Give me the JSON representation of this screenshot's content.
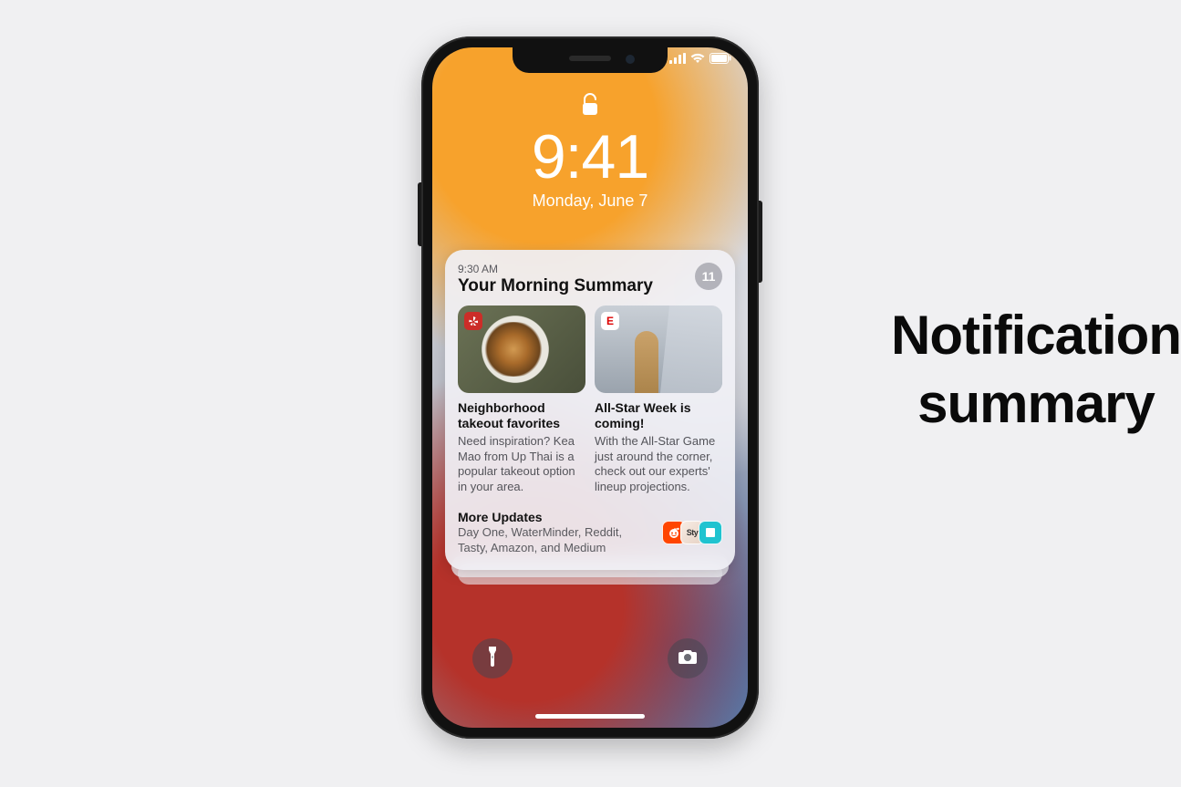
{
  "caption": {
    "line1": "Notification",
    "line2": "summary"
  },
  "lockscreen": {
    "time": "9:41",
    "date": "Monday, June 7"
  },
  "summary": {
    "timestamp": "9:30 AM",
    "title": "Your Morning Summary",
    "count": "11",
    "items": [
      {
        "app_badge": "yelp",
        "title": "Neighborhood takeout favorites",
        "body": "Need inspiration? Kea Mao from Up Thai is a popular takeout option in your area."
      },
      {
        "app_badge": "E",
        "title": "All-Star Week is coming!",
        "body": "With the All-Star Game just around the corner, check out our experts' lineup projections."
      }
    ],
    "more": {
      "label": "More Updates",
      "apps_text": "Day One, WaterMinder, Reddit, Tasty, Amazon, and Medium"
    }
  },
  "icons": {
    "lock": "lock-icon",
    "signal": "signal-icon",
    "wifi": "wifi-icon",
    "battery": "battery-icon",
    "flashlight": "flashlight-icon",
    "camera": "camera-icon",
    "reddit": "reddit-icon",
    "tasty": "Sty",
    "medium": "medium-icon"
  }
}
